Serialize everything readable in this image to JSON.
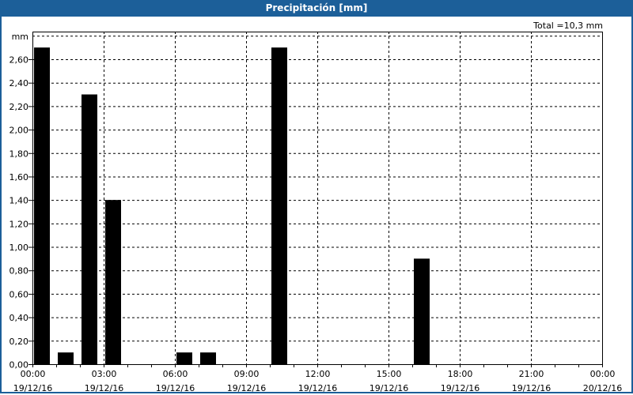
{
  "window": {
    "title": "Precipitación [mm]"
  },
  "total_label": "Total =10,3 mm",
  "chart_data": {
    "type": "bar",
    "title": "Precipitación [mm]",
    "ylabel": "mm",
    "ylim": [
      0,
      2.8
    ],
    "yticks": [
      "0,00",
      "0,20",
      "0,40",
      "0,60",
      "0,80",
      "1,00",
      "1,20",
      "1,40",
      "1,60",
      "1,80",
      "2,00",
      "2,20",
      "2,40",
      "2,60"
    ],
    "xlim_hours": [
      0,
      24
    ],
    "xticks": [
      {
        "time": "00:00",
        "date": "19/12/16"
      },
      {
        "time": "03:00",
        "date": "19/12/16"
      },
      {
        "time": "06:00",
        "date": "19/12/16"
      },
      {
        "time": "09:00",
        "date": "19/12/16"
      },
      {
        "time": "12:00",
        "date": "19/12/16"
      },
      {
        "time": "15:00",
        "date": "19/12/16"
      },
      {
        "time": "18:00",
        "date": "19/12/16"
      },
      {
        "time": "21:00",
        "date": "19/12/16"
      },
      {
        "time": "00:00",
        "date": "20/12/16"
      }
    ],
    "bars": [
      {
        "hour": 0,
        "value": 2.7
      },
      {
        "hour": 1,
        "value": 0.1
      },
      {
        "hour": 2,
        "value": 2.3
      },
      {
        "hour": 3,
        "value": 1.4
      },
      {
        "hour": 6,
        "value": 0.1
      },
      {
        "hour": 7,
        "value": 0.1
      },
      {
        "hour": 10,
        "value": 2.7
      },
      {
        "hour": 16,
        "value": 0.9
      }
    ],
    "grid": true,
    "bar_color": "#000000"
  }
}
